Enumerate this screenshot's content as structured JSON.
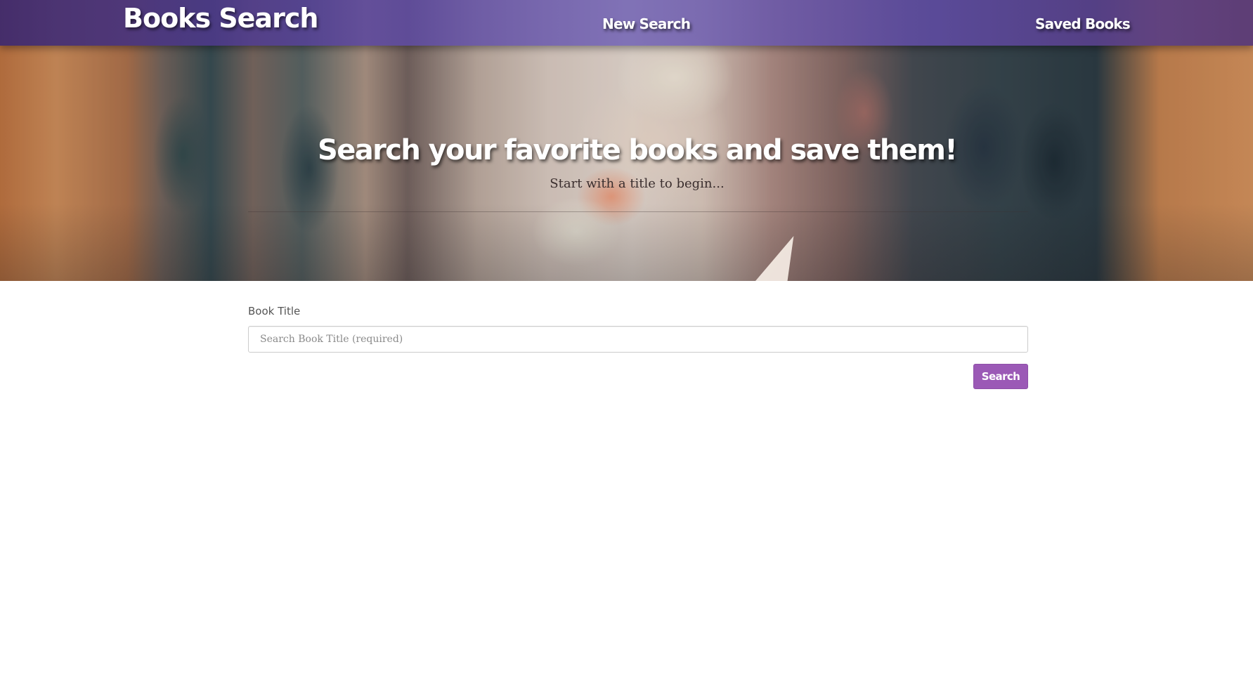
{
  "navbar": {
    "brand": "Books Search",
    "links": [
      {
        "label": "New Search"
      },
      {
        "label": "Saved Books"
      }
    ]
  },
  "hero": {
    "title": "Search your favorite books and save them!",
    "subtitle": "Start with a title to begin..."
  },
  "form": {
    "label": "Book Title",
    "input_value": "",
    "input_placeholder": "Search Book Title (required)",
    "button_label": "Search"
  },
  "colors": {
    "navbar": "#5a46a0",
    "button": "#9b59b6",
    "label_text": "#555555"
  }
}
